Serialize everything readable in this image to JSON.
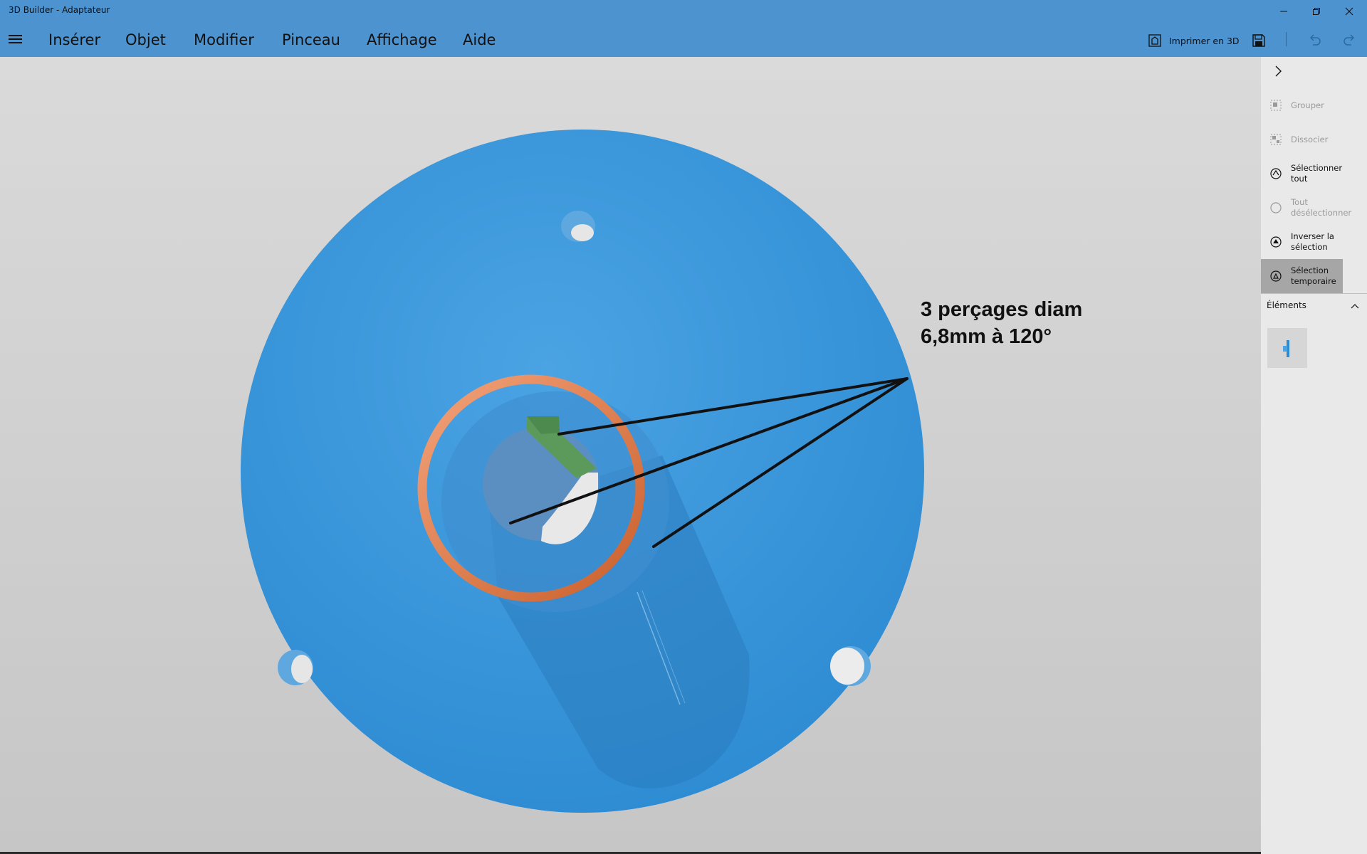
{
  "window": {
    "title": "3D Builder - Adaptateur",
    "controls": [
      "minimize-icon",
      "restore-icon",
      "close-icon"
    ]
  },
  "menu": {
    "hamburger_icon": "hamburger-menu-icon",
    "items": [
      {
        "label": "Insérer"
      },
      {
        "label": "Objet"
      },
      {
        "label": "Modifier"
      },
      {
        "label": "Pinceau"
      },
      {
        "label": "Affichage"
      },
      {
        "label": "Aide"
      }
    ]
  },
  "toolbar": {
    "print_label": "Imprimer en 3D",
    "print_icon": "print-3d-icon",
    "save_icon": "save-icon",
    "undo_icon": "undo-icon",
    "redo_icon": "redo-icon"
  },
  "annotation": {
    "line1": "3 perçages diam",
    "line2": "6,8mm à 120°"
  },
  "panel": {
    "toggle_icon": "chevron-right-icon",
    "items": [
      {
        "label": "Grouper",
        "icon": "group-icon",
        "enabled": false
      },
      {
        "label": "Dissocier",
        "icon": "ungroup-icon",
        "enabled": false
      },
      {
        "label": "Sélectionner tout",
        "icon": "select-all-icon",
        "enabled": true
      },
      {
        "label": "Tout désélectionner",
        "icon": "deselect-icon",
        "enabled": false
      },
      {
        "label": "Inverser la sélection",
        "icon": "invert-selection-icon",
        "enabled": true
      },
      {
        "label": "Sélection temporaire",
        "icon": "temporary-selection-icon",
        "enabled": true,
        "active": true
      }
    ],
    "elements": {
      "title": "Éléments",
      "collapse_icon": "chevron-up-icon"
    }
  },
  "colors": {
    "header": "#4d93cf",
    "part_blue": "#3a97d9",
    "ring_orange": "#d9743f",
    "key_green": "#5a8f5a",
    "panel_bg": "#e9e9e9",
    "active_item": "#a6a6a6"
  }
}
